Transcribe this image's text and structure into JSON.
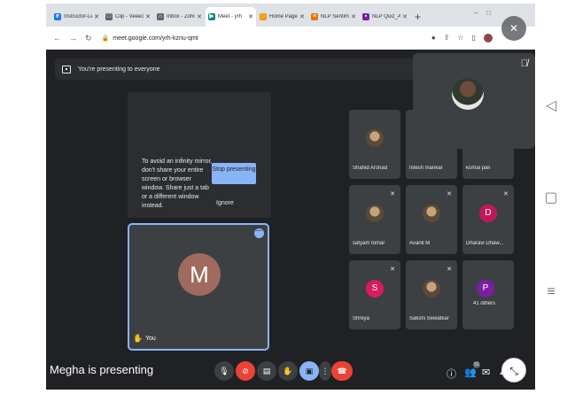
{
  "browser": {
    "tabs": [
      {
        "label": "Instructor-Led",
        "fav": "e",
        "fav_color": "#1a73e8",
        "active": false
      },
      {
        "label": "Clip - Veeeob",
        "fav": "□",
        "fav_color": "#5f6368",
        "active": false
      },
      {
        "label": "Inbox - Zoho",
        "fav": "⌂",
        "fav_color": "#5f6368",
        "active": false
      },
      {
        "label": "Meet - yrh",
        "fav": "▶",
        "fav_color": "#00897b",
        "active": true
      },
      {
        "label": "Home Page",
        "fav": "○",
        "fav_color": "#f29900",
        "active": false
      },
      {
        "label": "NLP Sentime",
        "fav": "≡",
        "fav_color": "#e8710a",
        "active": false
      },
      {
        "label": "NLP Quiz_Ans",
        "fav": "▪",
        "fav_color": "#7b1fa2",
        "active": false
      }
    ],
    "new_tab": "+",
    "url": "meet.google.com/yrh-kznu-qmt"
  },
  "meet": {
    "banner_text": "You're presenting to everyone",
    "present_warning": "To avoid an infinity mirror, don't share your entire screen or browser window. Share just a tab or a different window instead.",
    "stop_label": "Stop presenting",
    "ignore_label": "Ignore",
    "self_initial": "M",
    "self_label": "You",
    "presenter_text": "Megha is presenting",
    "participants": [
      {
        "name": "Shahid Arshad",
        "type": "photo"
      },
      {
        "name": "nitesh mankar",
        "type": "photo"
      },
      {
        "name": "komal pali",
        "type": "photo"
      },
      {
        "name": "satyam tomar",
        "type": "photo"
      },
      {
        "name": "Avanti M",
        "type": "photo"
      },
      {
        "name": "Dharavi Dhaw...",
        "type": "initial",
        "initial": "D",
        "color": "#c2185b"
      },
      {
        "name": "Shreya",
        "type": "initial",
        "initial": "S",
        "color": "#d81b60"
      },
      {
        "name": "Sakshi Sewatkar",
        "type": "photo"
      },
      {
        "name": "41 others",
        "type": "initial",
        "initial": "P",
        "color": "#7b1fa2"
      }
    ],
    "participant_count": "51"
  },
  "colors": {
    "accent": "#8ab4f8",
    "danger": "#ea4335",
    "surface": "#3c4043",
    "background": "#202124"
  }
}
